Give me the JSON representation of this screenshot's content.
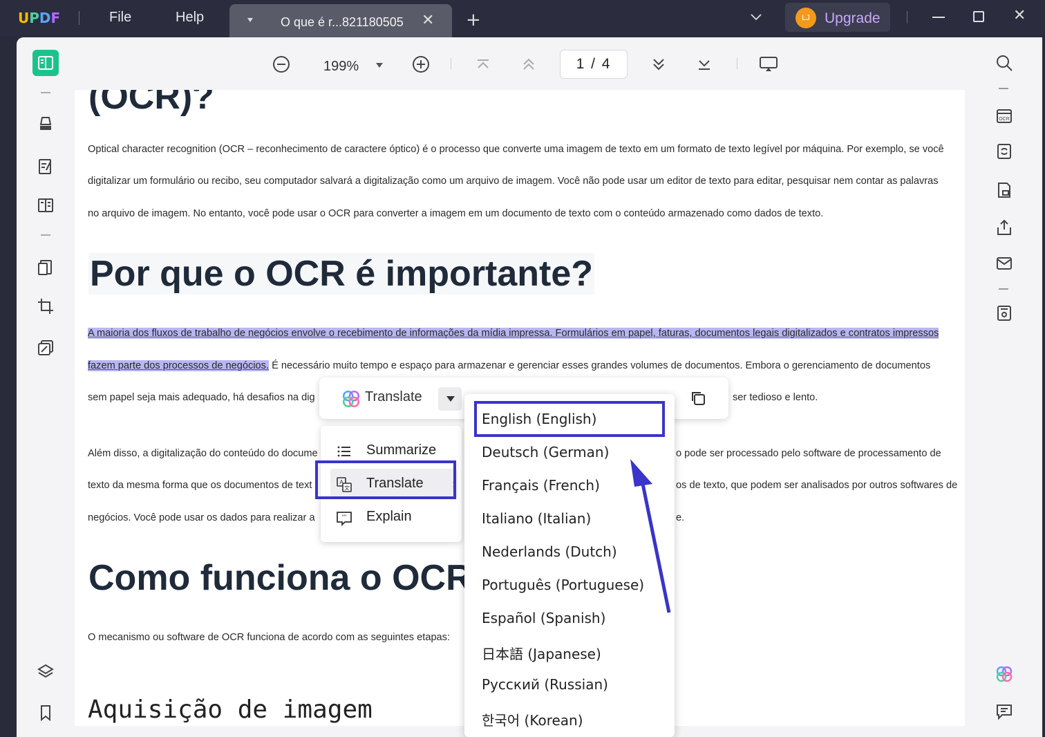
{
  "titlebar": {
    "logo": "UPDF",
    "menu": [
      "File",
      "Help"
    ],
    "tab_title": "O que é r...821180505",
    "upgrade_label": "Upgrade",
    "avatar_initials": "LJ"
  },
  "toolbar": {
    "zoom": "199%",
    "page_current": "1",
    "page_total": "4",
    "page_display": "1 / 4"
  },
  "document": {
    "heading_top": "(OCR)?",
    "para1": [
      "Optical character recognition (OCR – reconhecimento de caractere óptico) é o processo que converte uma imagem de texto em um formato de texto legível por máquina. Por exemplo, se você",
      "digitalizar um formulário ou recibo, seu computador salvará a digitalização como um arquivo de imagem. Você não pode usar um editor de texto para editar, pesquisar nem contar as palavras",
      "no arquivo de imagem. No entanto, você pode usar o OCR para converter a imagem em um documento de texto com o conteúdo armazenado como dados de texto."
    ],
    "heading_why": "Por que o OCR é importante?",
    "para2_highlight_line1": "A maioria dos fluxos de trabalho de negócios envolve o recebimento de informações da mídia impressa. Formulários em papel, faturas, documentos legais digitalizados e contratos impressos",
    "para2_highlight_line2": "fazem parte dos processos de negócios.",
    "para2_rest_line2": " É necessário muito tempo e espaço para armazenar e gerenciar esses grandes volumes de documentos. Embora o gerenciamento de documentos",
    "para2_line3_start": "sem papel seja mais adequado, há desafios na dig",
    "para2_line3_end": "ser tedioso e lento.",
    "para3_line1_start": "Além disso, a digitalização do conteúdo do docume",
    "para3_line1_end": "o pode ser processado pelo software de processamento de",
    "para3_line2_start": "texto da mesma forma que os documentos de text",
    "para3_line2_end": "os de texto, que podem ser analisados por outros softwares de",
    "para3_line3_start": "negócios. Você pode usar os dados para realizar a",
    "para3_line3_end": "e.",
    "heading_how": "Como funciona o OCR",
    "para4": "O mecanismo ou software de OCR funciona de acordo com as seguintes etapas:",
    "heading_acq": "Aquisição de imagem"
  },
  "float_bar": {
    "translate_label": "Translate"
  },
  "ai_menu": {
    "items": [
      {
        "label": "Summarize"
      },
      {
        "label": "Translate"
      },
      {
        "label": "Explain"
      }
    ]
  },
  "languages": [
    "English (English)",
    "Deutsch (German)",
    "Français (French)",
    "Italiano (Italian)",
    "Nederlands (Dutch)",
    "Português (Portuguese)",
    "Español (Spanish)",
    "日本語 (Japanese)",
    "Русский (Russian)",
    "한국어 (Korean)"
  ],
  "colors": {
    "accent_green": "#1bc38a",
    "highlight": "#b8b6f2",
    "callout_blue": "#3a34c8",
    "upgrade_text": "#c9a6ff"
  }
}
